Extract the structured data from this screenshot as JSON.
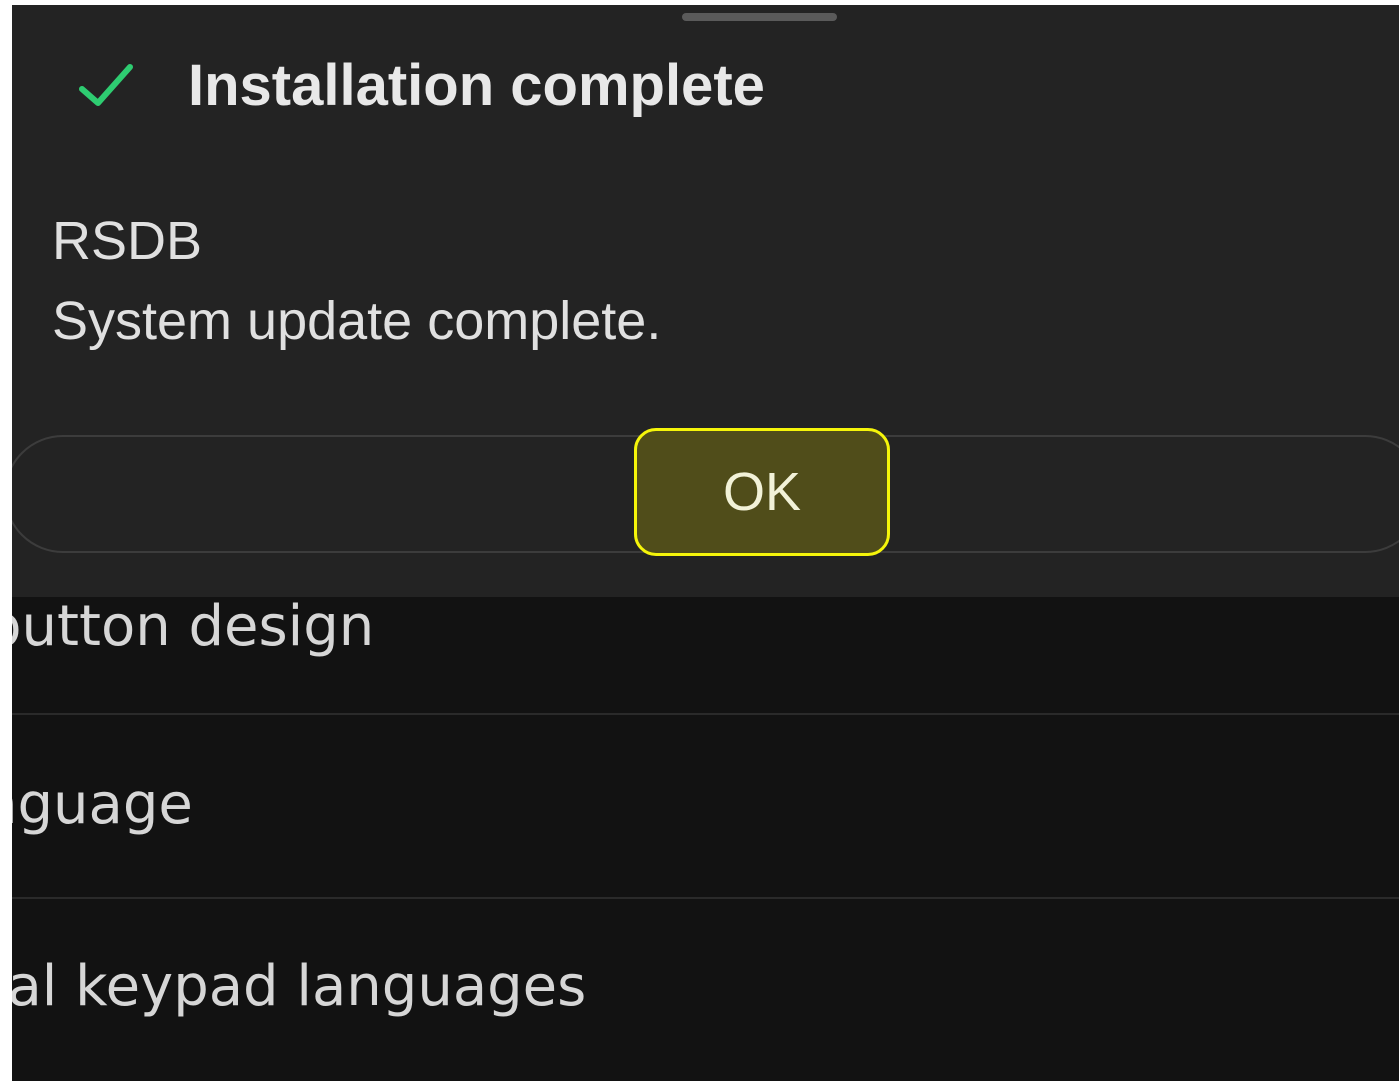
{
  "dialog": {
    "title": "Installation complete",
    "app_name": "RSDB",
    "message": "System update complete.",
    "ok_label": "OK",
    "check_icon": "checkmark-icon",
    "accent_color": "#2ecc71",
    "highlight_color": "#f5f50a"
  },
  "settings": {
    "items": [
      {
        "label": "button design"
      },
      {
        "label": "nguage"
      },
      {
        "label": "nal keypad languages"
      }
    ]
  }
}
